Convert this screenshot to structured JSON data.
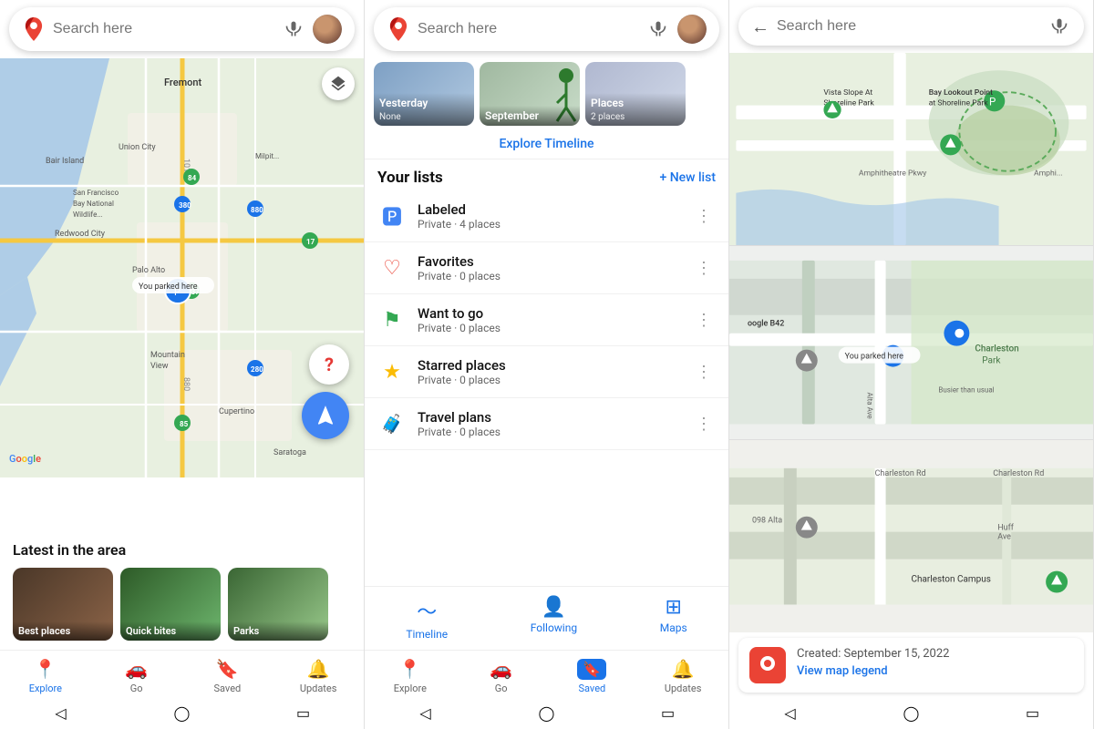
{
  "panel1": {
    "search_placeholder": "Search here",
    "latest_title": "Latest in the area",
    "cards": [
      {
        "label": "Best places",
        "bg": "card-bg-1"
      },
      {
        "label": "Quick bites",
        "bg": "card-bg-2"
      },
      {
        "label": "Parks",
        "bg": "card-bg-3"
      }
    ],
    "nav": [
      {
        "id": "explore",
        "label": "Explore",
        "icon": "📍",
        "active": true
      },
      {
        "id": "go",
        "label": "Go",
        "icon": "🚗",
        "active": false
      },
      {
        "id": "saved",
        "label": "Saved",
        "icon": "🔖",
        "active": false
      },
      {
        "id": "updates",
        "label": "Updates",
        "icon": "🔔",
        "active": false
      }
    ],
    "parked_label": "You parked here",
    "layers_icon": "◫",
    "google_text": "Google"
  },
  "panel2": {
    "search_placeholder": "Search here",
    "timeline_cards": [
      {
        "label": "Yesterday",
        "sub": "None",
        "bg": "tc-bg-1"
      },
      {
        "label": "September",
        "sub": "",
        "bg": "tc-bg-2"
      },
      {
        "label": "Places",
        "sub": "2 places",
        "bg": "tc-bg-3"
      }
    ],
    "explore_timeline_label": "Explore Timeline",
    "your_lists_title": "Your lists",
    "new_list_label": "+ New list",
    "lists": [
      {
        "icon": "🅿",
        "color": "#4285f4",
        "name": "Labeled",
        "meta": "Private · 4 places"
      },
      {
        "icon": "♡",
        "color": "#ea4335",
        "name": "Favorites",
        "meta": "Private · 0 places"
      },
      {
        "icon": "⚑",
        "color": "#34a853",
        "name": "Want to go",
        "meta": "Private · 0 places"
      },
      {
        "icon": "★",
        "color": "#fbbc05",
        "name": "Starred places",
        "meta": "Private · 0 places"
      },
      {
        "icon": "🧳",
        "color": "#4285f4",
        "name": "Travel plans",
        "meta": "Private · 0 places"
      }
    ],
    "tabs": [
      {
        "id": "timeline",
        "label": "Timeline",
        "icon": "📈"
      },
      {
        "id": "following",
        "label": "Following",
        "icon": "👤"
      },
      {
        "id": "maps",
        "label": "Maps",
        "icon": "🗺"
      }
    ],
    "nav": [
      {
        "id": "explore",
        "label": "Explore",
        "icon": "📍",
        "active": false
      },
      {
        "id": "go",
        "label": "Go",
        "icon": "🚗",
        "active": false
      },
      {
        "id": "saved",
        "label": "Saved",
        "icon": "🔖",
        "active": true
      },
      {
        "id": "updates",
        "label": "Updates",
        "icon": "🔔",
        "active": false
      }
    ]
  },
  "panel3": {
    "search_placeholder": "Search here",
    "pin_created": "Created: September 15, 2022",
    "view_legend_label": "View map legend",
    "parked_label": "You parked here",
    "nav": [
      {
        "id": "back",
        "icon": "←"
      }
    ]
  }
}
